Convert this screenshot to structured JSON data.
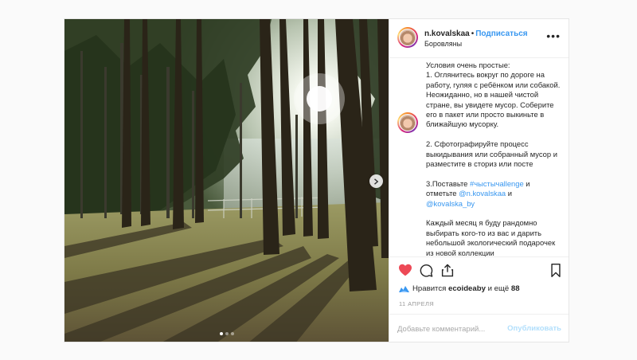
{
  "post": {
    "username": "n.kovalskaa",
    "follow_label": "Подписаться",
    "separator": "•",
    "location": "Боровляны",
    "more_label": "•••",
    "caption_lines": [
      "Условия очень простые:",
      "1. Оглянитесь вокруг по дороге на работу, гуляя с ребёнком или собакой. Неожиданно, но в нашей чистой стране, вы увидете мусор. Соберите его в пакет или просто выкиньте в ближайшую мусорку.",
      "",
      "2. Сфотографируйте процесс выкидывания или собранный мусор и разместите в сториз или посте",
      "",
      "3.Поставьте ",
      "",
      "Каждый месяц я буду рандомно выбирать кого-то из вас и дарить небольшой экологический подарочек из новой коллекции"
    ],
    "step3_prefix": "3.Поставьте ",
    "hashtag": "#чыстычallenge",
    "step3_middle": " и отметьте ",
    "mention_1": "@n.kovalskaa",
    "step3_and": " и ",
    "mention_2": "@kovalska_by",
    "likes_prefix": "Нравится ",
    "likes_user": "ecoideaby",
    "likes_middle": " и ещё ",
    "likes_count": "88",
    "date": "11 АПРЕЛЯ",
    "comment_placeholder": "Добавьте комментарий...",
    "publish_label": "Опубликовать",
    "carousel_dots": 3,
    "carousel_active": 1
  },
  "colors": {
    "link": "#3897f0",
    "like_red": "#ed4956",
    "publish_disabled": "#b2dffc"
  },
  "icons": {
    "like": "heart-icon",
    "comment": "comment-icon",
    "share": "share-icon",
    "save": "bookmark-icon",
    "next": "chevron-right-icon"
  }
}
